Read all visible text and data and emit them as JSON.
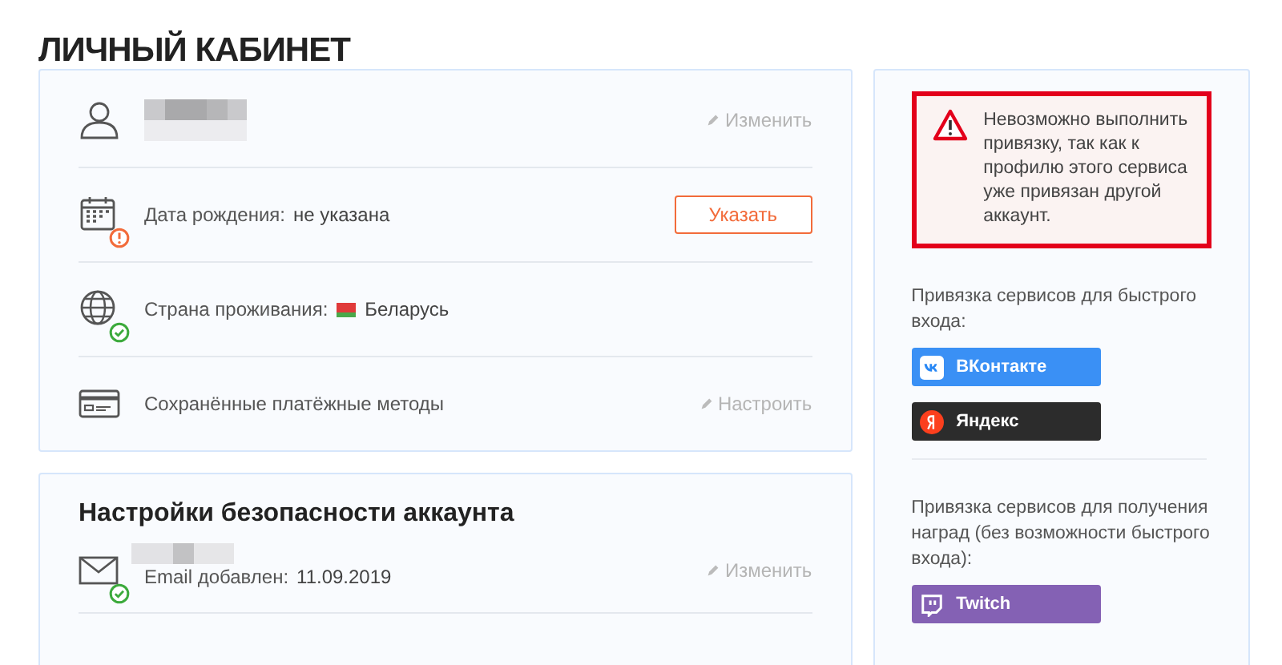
{
  "page_title": "ЛИЧНЫЙ КАБИНЕТ",
  "profile_rows": [
    {
      "kind": "name",
      "action": "Изменить"
    },
    {
      "kind": "birthday",
      "label": "Дата рождения:",
      "value": "не указана",
      "verified": false,
      "button": "Указать"
    },
    {
      "kind": "country",
      "label": "Страна проживания:",
      "value": "Беларусь",
      "verified": true
    },
    {
      "kind": "payment",
      "label": "Сохранённые платёжные методы",
      "action": "Настроить"
    }
  ],
  "security": {
    "title": "Настройки безопасности аккаунта",
    "rows": [
      {
        "kind": "email",
        "label": "Email добавлен:",
        "value": "11.09.2019",
        "verified": true,
        "action": "Изменить"
      }
    ]
  },
  "alert": {
    "text": "Невозможно выполнить привязку, так как к профилю этого сервиса уже привязан другой аккаунт."
  },
  "login_services": {
    "label": "Привязка сервисов для быстрого входа:",
    "buttons": [
      {
        "kind": "vk",
        "label": "ВКонтакте"
      },
      {
        "kind": "yandex",
        "label": "Яндекс"
      }
    ]
  },
  "reward_services": {
    "label": "Привязка сервисов для получения наград (без возможности быстрого входа):",
    "buttons": [
      {
        "kind": "twitch",
        "label": "Twitch"
      }
    ]
  }
}
